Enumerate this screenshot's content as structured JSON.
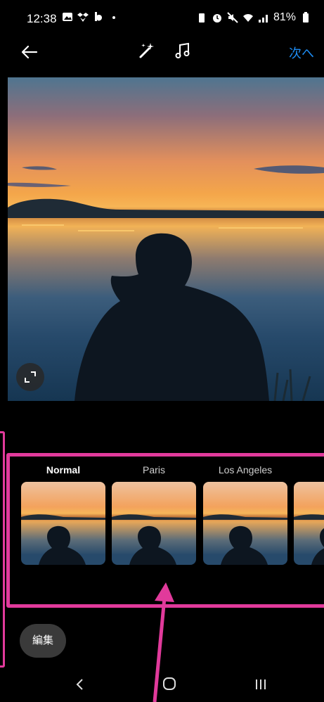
{
  "status_bar": {
    "time": "12:38",
    "battery": "81%",
    "icons": [
      "gallery-icon",
      "dropbox-icon",
      "b-icon",
      "dot-icon",
      "battery-saver-icon",
      "alarm-icon",
      "mute-icon",
      "wifi-icon",
      "signal-icon",
      "battery-icon"
    ]
  },
  "top_bar": {
    "next_label": "次へ",
    "icons": [
      "back-arrow-icon",
      "magic-wand-icon",
      "music-note-icon"
    ]
  },
  "filters": [
    {
      "label": "Normal",
      "selected": true
    },
    {
      "label": "Paris",
      "selected": false
    },
    {
      "label": "Los Angeles",
      "selected": false
    },
    {
      "label": "",
      "selected": false
    }
  ],
  "edit_button": {
    "label": "編集"
  },
  "nav_bar": {
    "icons": [
      "nav-back-icon",
      "nav-home-icon",
      "nav-recent-icon"
    ]
  },
  "colors": {
    "accent": "#1d8bf1",
    "annotation": "#e13a9b",
    "background": "#000000"
  }
}
